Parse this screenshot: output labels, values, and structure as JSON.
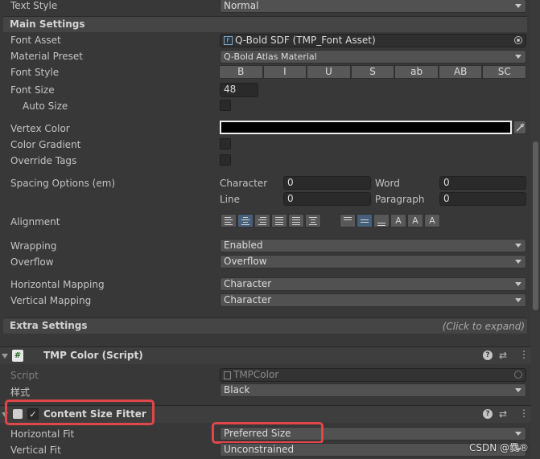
{
  "text_style": {
    "label": "Text Style",
    "value": "Normal"
  },
  "main_settings": {
    "title": "Main Settings",
    "font_asset": {
      "label": "Font Asset",
      "value": "Q-Bold SDF (TMP_Font Asset)"
    },
    "material_preset": {
      "label": "Material Preset",
      "value": "Q-Bold Atlas Material"
    },
    "font_style": {
      "label": "Font Style",
      "buttons": [
        "B",
        "I",
        "U",
        "S",
        "ab",
        "AB",
        "SC"
      ]
    },
    "font_size": {
      "label": "Font Size",
      "value": "48"
    },
    "auto_size": {
      "label": "Auto Size"
    },
    "vertex_color": {
      "label": "Vertex Color",
      "value": "#000000"
    },
    "color_gradient": {
      "label": "Color Gradient"
    },
    "override_tags": {
      "label": "Override Tags"
    },
    "spacing": {
      "label": "Spacing Options (em)",
      "character_label": "Character",
      "character_value": "0",
      "word_label": "Word",
      "word_value": "0",
      "line_label": "Line",
      "line_value": "0",
      "paragraph_label": "Paragraph",
      "paragraph_value": "0"
    },
    "alignment": {
      "label": "Alignment",
      "horizontal_selected": "center",
      "vertical_selected": "middle"
    },
    "wrapping": {
      "label": "Wrapping",
      "value": "Enabled"
    },
    "overflow": {
      "label": "Overflow",
      "value": "Overflow"
    },
    "horizontal_mapping": {
      "label": "Horizontal Mapping",
      "value": "Character"
    },
    "vertical_mapping": {
      "label": "Vertical Mapping",
      "value": "Character"
    }
  },
  "extra_settings": {
    "title": "Extra Settings",
    "hint": "(Click to expand)"
  },
  "tmp_color": {
    "title": "TMP Color (Script)",
    "script_label": "Script",
    "script_value": "TMPColor",
    "style_label": "样式",
    "style_value": "Black"
  },
  "content_size_fitter": {
    "title": "Content Size Fitter",
    "horizontal_fit_label": "Horizontal Fit",
    "horizontal_fit_value": "Preferred Size",
    "vertical_fit_label": "Vertical Fit",
    "vertical_fit_value": "Unconstrained"
  },
  "watermark": "CSDN @爨®",
  "colors": {
    "highlight": "#e0464a",
    "selected_button": "#46607c",
    "panel": "#383838"
  }
}
